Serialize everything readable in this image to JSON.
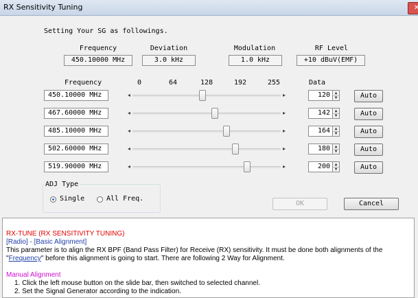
{
  "window": {
    "title": "RX Sensitivity Tuning"
  },
  "intro": "Setting Your SG as followings.",
  "sg": {
    "headers": [
      "Frequency",
      "Deviation",
      "Modulation",
      "RF Level"
    ],
    "values": [
      "450.10000 MHz",
      "3.0 kHz",
      "1.0 kHz",
      "+10 dBuV(EMF)"
    ]
  },
  "table": {
    "freq_header": "Frequency",
    "data_header": "Data",
    "scale_ticks": [
      "0",
      "64",
      "128",
      "192",
      "255"
    ],
    "rows": [
      {
        "frequency": "450.10000 MHz",
        "value": 120,
        "data": "120",
        "auto": "Auto"
      },
      {
        "frequency": "467.60000 MHz",
        "value": 142,
        "data": "142",
        "auto": "Auto"
      },
      {
        "frequency": "485.10000 MHz",
        "value": 164,
        "data": "164",
        "auto": "Auto"
      },
      {
        "frequency": "502.60000 MHz",
        "value": 180,
        "data": "180",
        "auto": "Auto"
      },
      {
        "frequency": "519.90000 MHz",
        "value": 200,
        "data": "200",
        "auto": "Auto"
      }
    ],
    "slider_max": 255
  },
  "adj_type": {
    "label": "ADJ Type",
    "options": [
      "Single",
      "All Freq."
    ],
    "selected": "Single"
  },
  "buttons": {
    "ok": "OK",
    "cancel": "Cancel"
  },
  "description": {
    "title": "RX-TUNE (RX SENSITIVITY TUNING)",
    "path": "[Radio] - [Basic Alignment]",
    "body_1": "This parameter is to align the RX BPF (Band Pass Filter) for Receive (RX) sensitivity. It must be done both alignments of the",
    "body_2_quote_open": "\"",
    "body_2_link": "Frequency",
    "body_2_rest": "\" before this alignment is going to start. There are following 2 Way for Alignment.",
    "manual_heading": "Manual Alignment",
    "steps": [
      "1. Click the left mouse button on the slide bar, then switched to selected channel.",
      "2. Set the Signal Generator according to the indication."
    ]
  }
}
